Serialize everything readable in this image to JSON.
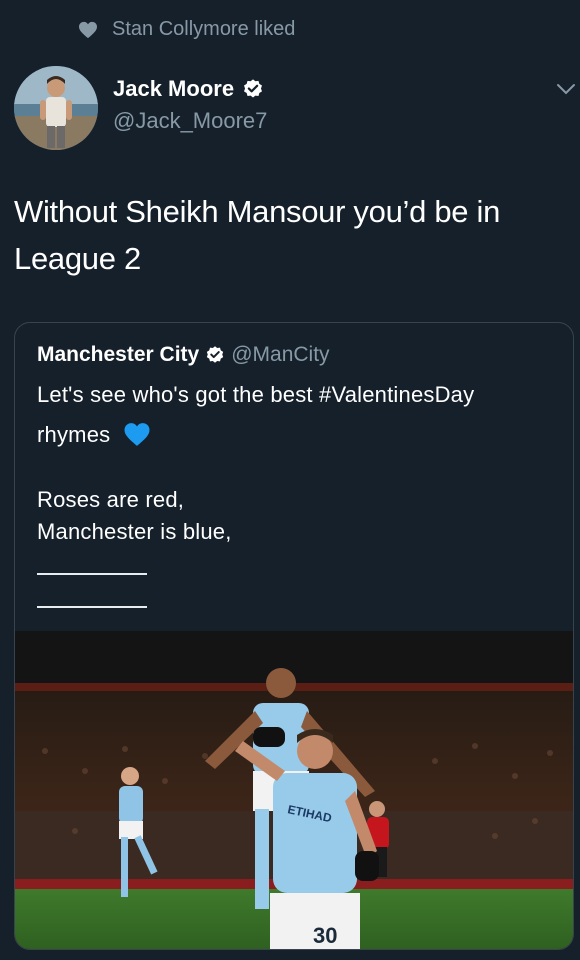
{
  "liked_banner": {
    "text": "Stan Collymore liked"
  },
  "author": {
    "name": "Jack Moore",
    "handle": "@Jack_Moore7"
  },
  "tweet": {
    "text_line1": "Without Sheikh Mansour you’d be in",
    "text_line2": "League 2"
  },
  "quote": {
    "name": "Manchester City",
    "handle": "@ManCity",
    "line1": "Let's see who's got the best #ValentinesDay",
    "line2": "rhymes",
    "line3": "Roses are red,",
    "line4": "Manchester is blue,"
  },
  "photo": {
    "jersey_number": "30",
    "sponsor": "ETIHAD"
  },
  "colors": {
    "background": "#15202b",
    "secondary_text": "#8899a6",
    "verified_blue": "#ffffff",
    "heart_blue": "#1d9bf0",
    "border": "#38444d"
  },
  "icons": [
    "heart-icon",
    "verified-icon",
    "chevron-down-icon",
    "blue-heart-icon"
  ]
}
